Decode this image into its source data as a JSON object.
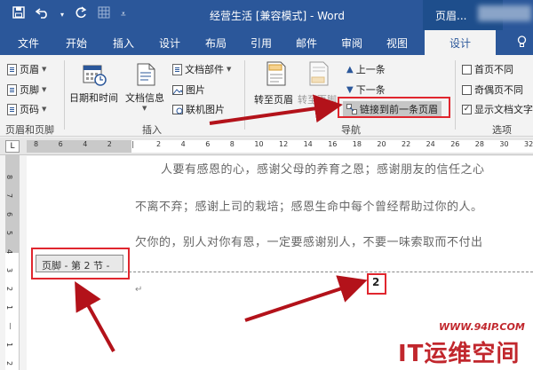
{
  "window": {
    "title": "经营生活 [兼容模式] - Word",
    "context_group": "页眉..."
  },
  "qat": {
    "save_icon": "save-icon",
    "undo_icon": "undo-icon",
    "redo_icon": "redo-icon",
    "customize_icon": "customize-qat-icon"
  },
  "tabs": [
    {
      "label": "文件"
    },
    {
      "label": "开始"
    },
    {
      "label": "插入"
    },
    {
      "label": "设计"
    },
    {
      "label": "布局"
    },
    {
      "label": "引用"
    },
    {
      "label": "邮件"
    },
    {
      "label": "审阅"
    },
    {
      "label": "视图"
    },
    {
      "label": "设计",
      "active": true
    }
  ],
  "ribbon": {
    "header_footer": {
      "header": "页眉",
      "footer": "页脚",
      "page_number": "页码",
      "group_label": "页眉和页脚"
    },
    "insert": {
      "datetime": "日期和时间",
      "docinfo": "文档信息",
      "docparts": "文档部件",
      "picture": "图片",
      "online_picture": "联机图片",
      "group_label": "插入"
    },
    "navigation": {
      "goto_header": "转至页眉",
      "goto_footer": "转至页脚",
      "previous": "上一条",
      "next": "下一条",
      "link_to_previous": "链接到前一条页眉",
      "group_label": "导航"
    },
    "options": {
      "different_first": "首页不同",
      "different_odd_even": "奇偶页不同",
      "show_doc_text": "显示文档文字",
      "group_label": "选项"
    }
  },
  "ruler": {
    "ticks": [
      "8",
      "6",
      "4",
      "2",
      "",
      "2",
      "4",
      "6",
      "8",
      "10",
      "12",
      "14",
      "16",
      "18",
      "20",
      "22",
      "24",
      "26",
      "28",
      "30",
      "32"
    ],
    "vticks": [
      "8",
      "7",
      "6",
      "5",
      "4",
      "3",
      "2",
      "1",
      "",
      "1",
      "2"
    ]
  },
  "document": {
    "lines": [
      "人要有感恩的心，感谢父母的养育之恩；感谢朋友的信任之心",
      "不离不弃；感谢上司的栽培；感恩生命中每个曾经帮助过你的人。",
      "欠你的，别人对你有恩，一定要感谢别人，不要一味索取而不付出"
    ],
    "footer_tag": "页脚 - 第 2 节 -",
    "page_number": "2"
  },
  "watermark": {
    "url": "WWW.94IP.COM",
    "brand": "IT运维空间"
  },
  "colors": {
    "word_blue": "#2b579a",
    "highlight_red": "#e0262e",
    "watermark_red": "#c1272d"
  }
}
